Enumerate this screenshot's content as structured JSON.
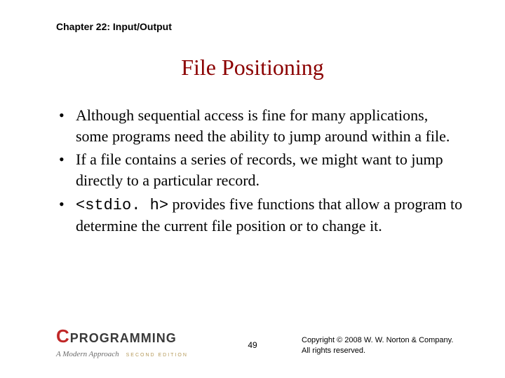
{
  "chapter_label": "Chapter 22: Input/Output",
  "title": "File Positioning",
  "bullets": [
    {
      "pre": "Although sequential access is fine for many applications, some programs need the ability to jump around within a file.",
      "code": "",
      "post": ""
    },
    {
      "pre": "If a file contains a series of records, we might want to jump directly to a particular record.",
      "code": "",
      "post": ""
    },
    {
      "pre": "",
      "code": "<stdio. h>",
      "post": " provides five functions that allow a program to determine the current file position or to change it."
    }
  ],
  "logo": {
    "c": "C",
    "word": "PROGRAMMING",
    "subtitle": "A Modern Approach",
    "edition": "SECOND EDITION"
  },
  "page_number": "49",
  "copyright_line1": "Copyright © 2008 W. W. Norton & Company.",
  "copyright_line2": "All rights reserved."
}
